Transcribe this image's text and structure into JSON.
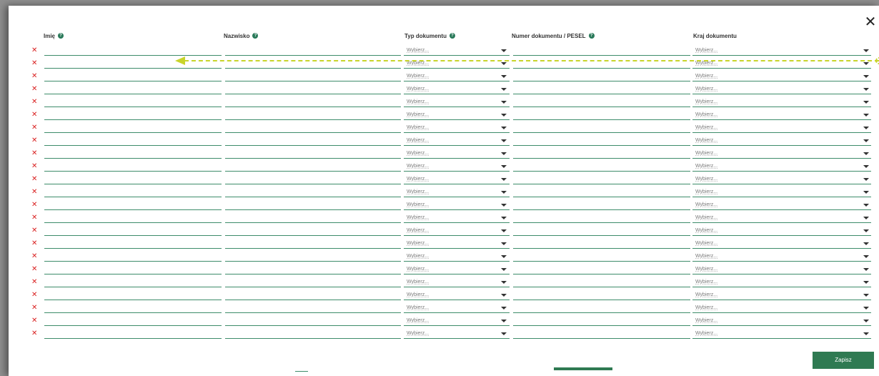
{
  "dialog": {
    "close_label": "✕"
  },
  "columns": {
    "first_name": "Imię",
    "last_name": "Nazwisko",
    "doc_type": "Typ dokumentu",
    "doc_number": "Numer dokumentu / PESEL",
    "doc_country": "Kraj dokumentu"
  },
  "help_glyph": "?",
  "remove_glyph": "✕",
  "select_placeholder": "Wybierz...",
  "row_count": 23,
  "footer": {
    "save_label": "Zapisz"
  },
  "colors": {
    "accent": "#2f7a52",
    "remove": "#d92020",
    "annotation": "#c8d42a"
  },
  "annotation": {
    "type": "dashed-arrow",
    "points_to": "first_name"
  }
}
